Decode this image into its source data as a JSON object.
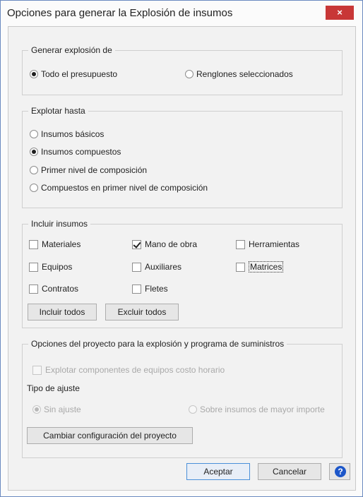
{
  "window": {
    "title": "Opciones para generar la Explosión de insumos",
    "close_glyph": "×"
  },
  "generar": {
    "legend": "Generar explosión de",
    "options": [
      {
        "label": "Todo el presupuesto",
        "checked": true
      },
      {
        "label": "Renglones seleccionados",
        "checked": false
      }
    ]
  },
  "explotar": {
    "legend": "Explotar hasta",
    "options": [
      {
        "label": "Insumos básicos",
        "checked": false
      },
      {
        "label": "Insumos compuestos",
        "checked": true
      },
      {
        "label": "Primer nivel de composición",
        "checked": false
      },
      {
        "label": "Compuestos en primer nivel de composición",
        "checked": false
      }
    ]
  },
  "incluir": {
    "legend": "Incluir insumos",
    "checkboxes": [
      {
        "label": "Materiales",
        "checked": false
      },
      {
        "label": "Mano de obra",
        "checked": true
      },
      {
        "label": "Herramientas",
        "checked": false
      },
      {
        "label": "Equipos",
        "checked": false
      },
      {
        "label": "Auxiliares",
        "checked": false
      },
      {
        "label": "Matrices",
        "checked": false
      },
      {
        "label": "Contratos",
        "checked": false
      },
      {
        "label": "Fletes",
        "checked": false
      }
    ],
    "incluir_todos": "Incluir todos",
    "excluir_todos": "Excluir todos"
  },
  "proyecto": {
    "legend": "Opciones del proyecto para la explosión y programa de suministros",
    "explotar_componentes": {
      "label": "Explotar componentes de equipos costo horario",
      "checked": false
    },
    "tipo_ajuste_label": "Tipo de ajuste",
    "ajuste_options": [
      {
        "label": "Sin ajuste",
        "checked": true
      },
      {
        "label": "Sobre insumos de mayor importe",
        "checked": false
      }
    ],
    "cambiar_config": "Cambiar configuración del proyecto"
  },
  "footer": {
    "aceptar": "Aceptar",
    "cancelar": "Cancelar",
    "help_glyph": "?"
  },
  "colors": {
    "close_button": "#c83737",
    "help_icon": "#1c56c9",
    "primary_border": "#4a90d9"
  }
}
